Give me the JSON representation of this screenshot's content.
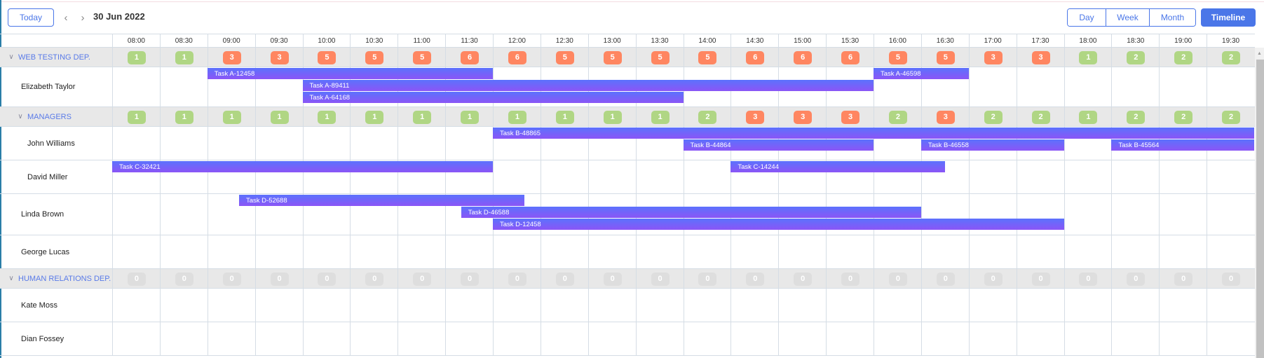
{
  "toolbar": {
    "today_label": "Today",
    "prev_icon": "chevron-left-icon",
    "next_icon": "chevron-right-icon",
    "date": "30 Jun 2022",
    "views": [
      "Day",
      "Week",
      "Month"
    ],
    "active_view": "Timeline"
  },
  "colors": {
    "accent": "#4a76e8",
    "badge_low": "#b0d684",
    "badge_high": "#ff8661",
    "badge_zero": "#dedede",
    "task_gradient_top": "#5c72fd",
    "task_gradient_bottom": "#8b55f6",
    "group_bg": "#e8e8e8"
  },
  "time_slots": [
    "08:00",
    "08:30",
    "09:00",
    "09:30",
    "10:00",
    "10:30",
    "11:00",
    "11:30",
    "12:00",
    "12:30",
    "13:00",
    "13:30",
    "14:00",
    "14:30",
    "15:00",
    "15:30",
    "16:00",
    "16:30",
    "17:00",
    "17:30",
    "18:00",
    "18:30",
    "19:00",
    "19:30"
  ],
  "timeline_end": "20:00",
  "rows": [
    {
      "type": "group",
      "name": "WEB TESTING DEP.",
      "indent": 0,
      "counts": [
        1,
        1,
        3,
        3,
        5,
        5,
        5,
        6,
        6,
        5,
        5,
        5,
        5,
        6,
        6,
        6,
        5,
        5,
        3,
        3,
        1,
        2,
        2,
        2
      ]
    },
    {
      "type": "resource",
      "name": "Elizabeth Taylor",
      "lanes": 3,
      "tasks": [
        {
          "label": "Task A-12458",
          "start": "09:00",
          "end": "12:00",
          "lane": 0
        },
        {
          "label": "Task A-89411",
          "start": "10:00",
          "end": "16:00",
          "lane": 1
        },
        {
          "label": "Task A-64168",
          "start": "10:00",
          "end": "14:00",
          "lane": 2
        },
        {
          "label": "Task A-46598",
          "start": "16:00",
          "end": "17:00",
          "lane": 0
        }
      ]
    },
    {
      "type": "group",
      "name": "MANAGERS",
      "indent": 1,
      "counts": [
        1,
        1,
        1,
        1,
        1,
        1,
        1,
        1,
        1,
        1,
        1,
        1,
        2,
        3,
        3,
        3,
        2,
        3,
        2,
        2,
        1,
        2,
        2,
        2
      ]
    },
    {
      "type": "resource",
      "name": "John Williams",
      "lanes": 2,
      "tasks": [
        {
          "label": "Task B-48865",
          "start": "12:00",
          "end": "20:00",
          "lane": 0
        },
        {
          "label": "Task B-44864",
          "start": "14:00",
          "end": "16:00",
          "lane": 1
        },
        {
          "label": "Task B-46558",
          "start": "16:30",
          "end": "18:00",
          "lane": 1
        },
        {
          "label": "Task B-45564",
          "start": "18:30",
          "end": "20:00",
          "lane": 1
        }
      ]
    },
    {
      "type": "resource",
      "name": "David Miller",
      "lanes": 2,
      "tasks": [
        {
          "label": "Task C-32421",
          "start": "08:00",
          "end": "12:00",
          "lane": 0
        },
        {
          "label": "Task C-14244",
          "start": "14:30",
          "end": "16:45",
          "lane": 0
        }
      ]
    },
    {
      "type": "resource",
      "name": "Linda Brown",
      "lanes": 3,
      "tasks": [
        {
          "label": "Task D-52688",
          "start": "09:20",
          "end": "12:20",
          "lane": 0
        },
        {
          "label": "Task D-46588",
          "start": "11:40",
          "end": "16:30",
          "lane": 1
        },
        {
          "label": "Task D-12458",
          "start": "12:00",
          "end": "18:00",
          "lane": 2
        }
      ]
    },
    {
      "type": "resource",
      "name": "George Lucas",
      "lanes": 2,
      "tasks": []
    },
    {
      "type": "group",
      "name": "HUMAN RELATIONS DEP.",
      "indent": 0,
      "counts": [
        0,
        0,
        0,
        0,
        0,
        0,
        0,
        0,
        0,
        0,
        0,
        0,
        0,
        0,
        0,
        0,
        0,
        0,
        0,
        0,
        0,
        0,
        0,
        0
      ]
    },
    {
      "type": "resource",
      "name": "Kate Moss",
      "lanes": 2,
      "tasks": []
    },
    {
      "type": "resource",
      "name": "Dian Fossey",
      "lanes": 2,
      "tasks": []
    }
  ]
}
